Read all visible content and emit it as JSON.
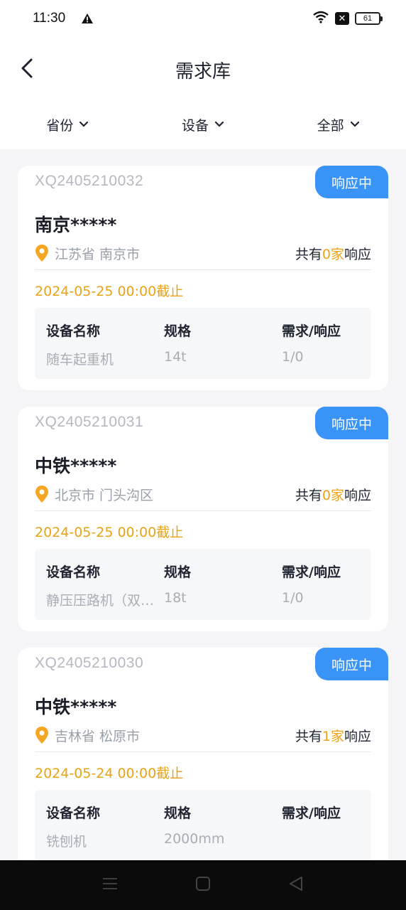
{
  "status_bar": {
    "time": "11:30",
    "battery": "61"
  },
  "nav": {
    "title": "需求库"
  },
  "filters": [
    {
      "label": "省份"
    },
    {
      "label": "设备"
    },
    {
      "label": "全部"
    }
  ],
  "cards": [
    {
      "code": "XQ2405210032",
      "badge": "响应中",
      "name": "南京*****",
      "location": "江苏省 南京市",
      "resp_prefix": "共有",
      "resp_count": "0家",
      "resp_suffix": "响应",
      "deadline": "2024-05-25 00:00截止",
      "headers": [
        "设备名称",
        "规格",
        "需求/响应"
      ],
      "equip_name": "随车起重机",
      "spec": "14t",
      "ratio": "1/0"
    },
    {
      "code": "XQ2405210031",
      "badge": "响应中",
      "name": "中铁*****",
      "location": "北京市 门头沟区",
      "resp_prefix": "共有",
      "resp_count": "0家",
      "resp_suffix": "响应",
      "deadline": "2024-05-25 00:00截止",
      "headers": [
        "设备名称",
        "规格",
        "需求/响应"
      ],
      "equip_name": "静压压路机（双…",
      "spec": "18t",
      "ratio": "1/0"
    },
    {
      "code": "XQ2405210030",
      "badge": "响应中",
      "name": "中铁*****",
      "location": "吉林省 松原市",
      "resp_prefix": "共有",
      "resp_count": "1家",
      "resp_suffix": "响应",
      "deadline": "2024-05-24 00:00截止",
      "headers": [
        "设备名称",
        "规格",
        "需求/响应"
      ],
      "equip_name": "铣刨机",
      "spec": "2000mm",
      "ratio": ""
    }
  ],
  "colors": {
    "accent_blue": "#3a93f7",
    "deadline_orange": "#e9a316",
    "count_orange": "#f0a21c",
    "pin_orange": "#f5a623"
  },
  "icons": [
    "back-chevron-icon",
    "chevron-down-icon",
    "location-pin-icon",
    "warning-icon",
    "wifi-icon",
    "close-box-icon",
    "battery-icon",
    "menu-icon",
    "home-icon",
    "back-triangle-icon"
  ]
}
